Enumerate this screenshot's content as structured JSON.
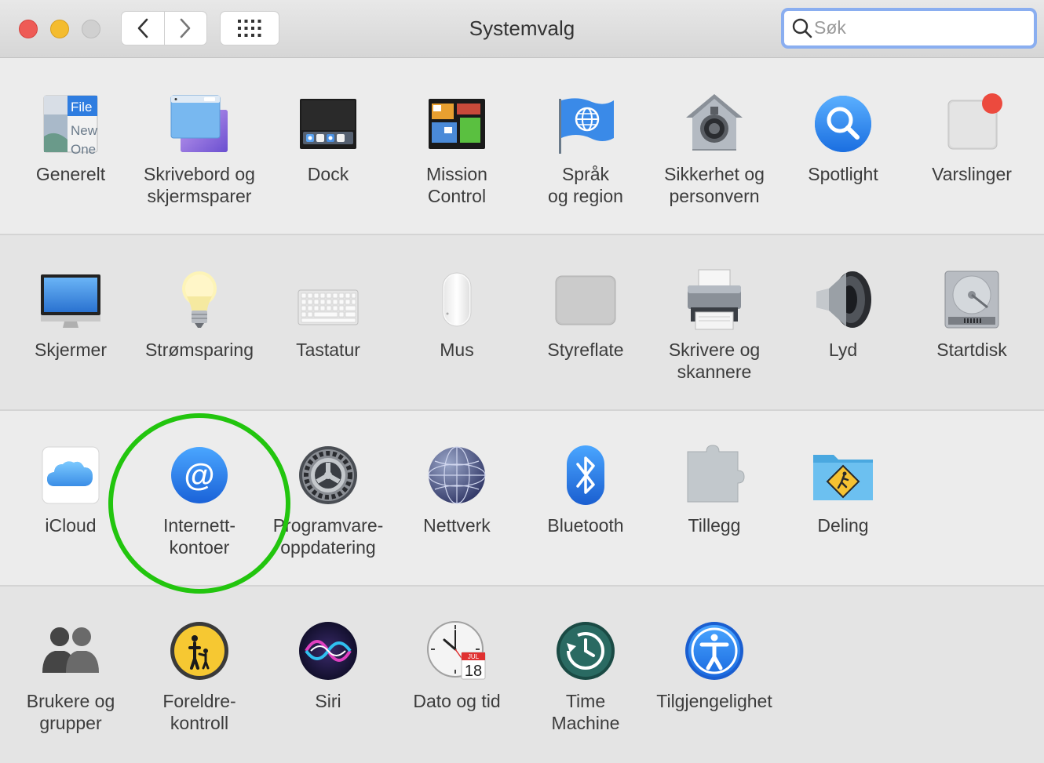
{
  "window": {
    "title": "Systemvalg",
    "search_placeholder": "Søk",
    "search_value": ""
  },
  "colors": {
    "close": "#ee5b56",
    "minimize": "#f4bc2f",
    "zoom_disabled": "#d0d0d0",
    "highlight_ring": "#22c50e",
    "search_focus": "#8aaef0"
  },
  "panes": [
    {
      "id": "generelt",
      "icon": "general-icon",
      "label": "Generelt"
    },
    {
      "id": "skrivebord",
      "icon": "desktop-screensaver-icon",
      "label": "Skrivebord og\nskjermsparer"
    },
    {
      "id": "dock",
      "icon": "dock-icon",
      "label": "Dock"
    },
    {
      "id": "mission-control",
      "icon": "mission-control-icon",
      "label": "Mission\nControl"
    },
    {
      "id": "sprak",
      "icon": "language-region-icon",
      "label": "Språk\nog region"
    },
    {
      "id": "sikkerhet",
      "icon": "security-privacy-icon",
      "label": "Sikkerhet og\npersonvern"
    },
    {
      "id": "spotlight",
      "icon": "spotlight-icon",
      "label": "Spotlight"
    },
    {
      "id": "varslinger",
      "icon": "notifications-icon",
      "label": "Varslinger"
    },
    {
      "id": "skjermer",
      "icon": "displays-icon",
      "label": "Skjermer"
    },
    {
      "id": "stromsparing",
      "icon": "energy-saver-icon",
      "label": "Strømsparing"
    },
    {
      "id": "tastatur",
      "icon": "keyboard-icon",
      "label": "Tastatur"
    },
    {
      "id": "mus",
      "icon": "mouse-icon",
      "label": "Mus"
    },
    {
      "id": "styreflate",
      "icon": "trackpad-icon",
      "label": "Styreflate"
    },
    {
      "id": "skrivere",
      "icon": "printer-icon",
      "label": "Skrivere og\nskannere"
    },
    {
      "id": "lyd",
      "icon": "sound-icon",
      "label": "Lyd"
    },
    {
      "id": "startdisk",
      "icon": "startup-disk-icon",
      "label": "Startdisk"
    },
    {
      "id": "icloud",
      "icon": "icloud-icon",
      "label": "iCloud"
    },
    {
      "id": "internettkontoer",
      "icon": "internet-accounts-icon",
      "label": "Internett-\nkontoer"
    },
    {
      "id": "programvareoppdatering",
      "icon": "software-update-icon",
      "label": "Programvare-\noppdatering"
    },
    {
      "id": "nettverk",
      "icon": "network-icon",
      "label": "Nettverk"
    },
    {
      "id": "bluetooth",
      "icon": "bluetooth-icon",
      "label": "Bluetooth"
    },
    {
      "id": "tillegg",
      "icon": "extensions-icon",
      "label": "Tillegg"
    },
    {
      "id": "deling",
      "icon": "sharing-icon",
      "label": "Deling"
    },
    {
      "id": "brukere",
      "icon": "users-groups-icon",
      "label": "Brukere og\ngrupper"
    },
    {
      "id": "foreldrekontroll",
      "icon": "parental-controls-icon",
      "label": "Foreldre-\nkontroll"
    },
    {
      "id": "siri",
      "icon": "siri-icon",
      "label": "Siri"
    },
    {
      "id": "dato",
      "icon": "date-time-icon",
      "label": "Dato og tid"
    },
    {
      "id": "timemachine",
      "icon": "time-machine-icon",
      "label": "Time\nMachine"
    },
    {
      "id": "tilgjengelighet",
      "icon": "accessibility-icon",
      "label": "Tilgjengelighet"
    }
  ],
  "icon_text": {
    "general_file": "File",
    "general_new": "New",
    "general_one": "One",
    "calendar_month": "JUL",
    "calendar_day": "18"
  }
}
